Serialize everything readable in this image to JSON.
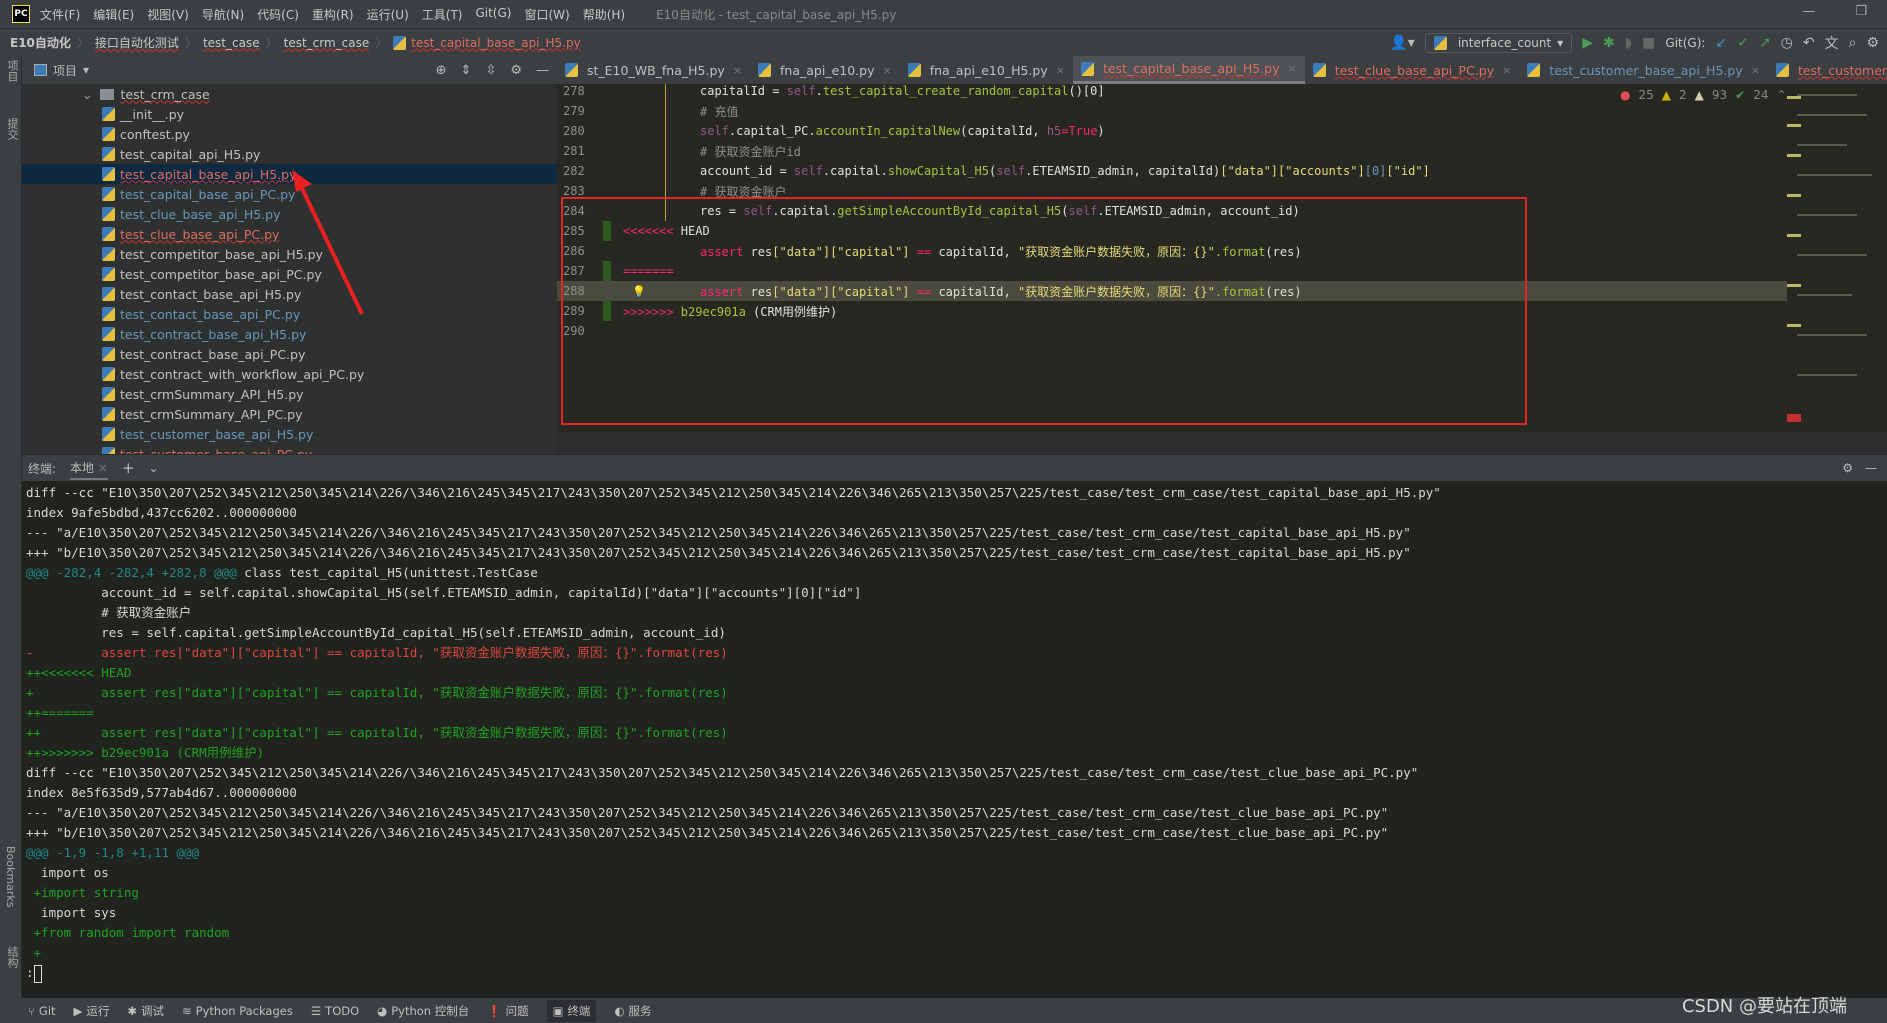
{
  "title_bar": {
    "logo": "PC",
    "menus": [
      "文件(F)",
      "编辑(E)",
      "视图(V)",
      "导航(N)",
      "代码(C)",
      "重构(R)",
      "运行(U)",
      "工具(T)",
      "Git(G)",
      "窗口(W)",
      "帮助(H)"
    ],
    "window_title": "E10自动化 - test_capital_base_api_H5.py"
  },
  "breadcrumb": [
    "E10自动化",
    "接口自动化测试",
    "test_case",
    "test_crm_case",
    "test_capital_base_api_H5.py"
  ],
  "toolbar": {
    "run_config": "interface_count",
    "git_label": "Git(G):"
  },
  "left_strip": {
    "project": "项目",
    "commit": "提交",
    "bookmarks": "Bookmarks",
    "structure": "结构"
  },
  "project_panel": {
    "title": "项目",
    "folder": "test_crm_case",
    "files": [
      {
        "name": "__init__.py",
        "status": "norm"
      },
      {
        "name": "conftest.py",
        "status": "norm"
      },
      {
        "name": "test_capital_api_H5.py",
        "status": "norm"
      },
      {
        "name": "test_capital_base_api_H5.py",
        "status": "conf",
        "selected": true
      },
      {
        "name": "test_capital_base_api_PC.py",
        "status": "mod"
      },
      {
        "name": "test_clue_base_api_H5.py",
        "status": "mod"
      },
      {
        "name": "test_clue_base_api_PC.py",
        "status": "conf"
      },
      {
        "name": "test_competitor_base_api_H5.py",
        "status": "norm"
      },
      {
        "name": "test_competitor_base_api_PC.py",
        "status": "norm"
      },
      {
        "name": "test_contact_base_api_H5.py",
        "status": "norm"
      },
      {
        "name": "test_contact_base_api_PC.py",
        "status": "mod"
      },
      {
        "name": "test_contract_base_api_H5.py",
        "status": "mod"
      },
      {
        "name": "test_contract_base_api_PC.py",
        "status": "norm"
      },
      {
        "name": "test_contract_with_workflow_api_PC.py",
        "status": "norm"
      },
      {
        "name": "test_crmSummary_API_H5.py",
        "status": "norm"
      },
      {
        "name": "test_crmSummary_API_PC.py",
        "status": "norm"
      },
      {
        "name": "test_customer_base_api_H5.py",
        "status": "mod"
      },
      {
        "name": "test_customer_base_api_PC.py",
        "status": "conf"
      }
    ]
  },
  "tabs": [
    {
      "label": "st_E10_WB_fna_H5.py",
      "status": "norm"
    },
    {
      "label": "fna_api_e10.py",
      "status": "norm"
    },
    {
      "label": "fna_api_e10_H5.py",
      "status": "norm"
    },
    {
      "label": "test_capital_base_api_H5.py",
      "status": "conf",
      "active": true
    },
    {
      "label": "test_clue_base_api_PC.py",
      "status": "conf"
    },
    {
      "label": "test_customer_base_api_H5.py",
      "status": "mod"
    },
    {
      "label": "test_customer_base_api_PC.py",
      "status": "conf"
    }
  ],
  "inspections": {
    "errors": "25",
    "warnings": "2",
    "weak_warnings": "93",
    "ok": "24"
  },
  "editor": {
    "lines": [
      {
        "num": "278",
        "segs": [
          [
            "pl",
            "capitalId = "
          ],
          [
            "self",
            "self"
          ],
          [
            "pl",
            "."
          ],
          [
            "fn",
            "test_capital_create_random_capital"
          ],
          [
            "pl",
            "()[0]"
          ]
        ]
      },
      {
        "num": "279",
        "segs": [
          [
            "cm",
            "# 充值"
          ]
        ]
      },
      {
        "num": "280",
        "segs": [
          [
            "self",
            "self"
          ],
          [
            "pl",
            "."
          ],
          [
            "pl",
            "capital_PC"
          ],
          [
            "pl",
            "."
          ],
          [
            "fn",
            "accountIn_capitalNew"
          ],
          [
            "pl",
            "(capitalId, "
          ],
          [
            "self",
            "h5"
          ],
          [
            "kw",
            "="
          ],
          [
            "kw",
            "True"
          ],
          [
            "pl",
            ")"
          ]
        ]
      },
      {
        "num": "281",
        "segs": [
          [
            "cm",
            "# 获取资金账户id"
          ]
        ]
      },
      {
        "num": "282",
        "segs": [
          [
            "pl",
            "account_id = "
          ],
          [
            "self",
            "self"
          ],
          [
            "pl",
            ".capital."
          ],
          [
            "fn",
            "showCapital_H5"
          ],
          [
            "pl",
            "("
          ],
          [
            "self",
            "self"
          ],
          [
            "pl",
            ".ETEAMSID_admin, capitalId)"
          ],
          [
            "str",
            "[\"data\"]"
          ],
          [
            "str",
            "[\"accounts\"]"
          ],
          [
            "num",
            "[0]"
          ],
          [
            "str",
            "[\"id\"]"
          ]
        ]
      },
      {
        "num": "283",
        "segs": [
          [
            "cm",
            "# 获取资金账户"
          ]
        ]
      },
      {
        "num": "284",
        "segs": [
          [
            "pl",
            "res = "
          ],
          [
            "self",
            "self"
          ],
          [
            "pl",
            ".capital."
          ],
          [
            "fn",
            "getSimpleAccountById_capital_H5"
          ],
          [
            "pl",
            "("
          ],
          [
            "self",
            "self"
          ],
          [
            "pl",
            ".ETEAMSID_admin, account_id)"
          ]
        ]
      },
      {
        "num": "285",
        "marker": true,
        "segs": [
          [
            "mk",
            "<<<<<<< "
          ],
          [
            "pl",
            "HEAD"
          ]
        ]
      },
      {
        "num": "286",
        "segs": [
          [
            "kw",
            "assert"
          ],
          [
            "pl",
            " res"
          ],
          [
            "str",
            "[\"data\"][\"capital\"]"
          ],
          [
            "kw",
            " == "
          ],
          [
            "pl",
            "capitalId, "
          ],
          [
            "str",
            "\"获取资金账户数据失败，原因：{}\""
          ],
          [
            "fn",
            ".format"
          ],
          [
            "pl",
            "(res)"
          ]
        ]
      },
      {
        "num": "287",
        "marker": true,
        "segs": [
          [
            "mk",
            "======="
          ]
        ]
      },
      {
        "num": "288",
        "highlight": true,
        "segs": [
          [
            "kw",
            "assert"
          ],
          [
            "pl",
            " res"
          ],
          [
            "str",
            "[\"data\"][\"capital\"]"
          ],
          [
            "kw",
            " == "
          ],
          [
            "pl",
            "capitalId, "
          ],
          [
            "str",
            "\"获取资金账户数据失败，原因：{}\""
          ],
          [
            "fn",
            ".format"
          ],
          [
            "pl",
            "(res)"
          ]
        ]
      },
      {
        "num": "289",
        "marker": true,
        "segs": [
          [
            "mk",
            ">>>>>>> "
          ],
          [
            "fn",
            "b29ec901a "
          ],
          [
            "pl",
            "(CRM用例维护)"
          ]
        ]
      },
      {
        "num": "290",
        "segs": []
      }
    ]
  },
  "terminal": {
    "tab_label": "终端:",
    "session": "本地",
    "lines": [
      {
        "c": "w",
        "t": "diff --cc \"E10\\350\\207\\252\\345\\212\\250\\345\\214\\226/\\346\\216\\245\\345\\217\\243\\350\\207\\252\\345\\212\\250\\345\\214\\226\\346\\265\\213\\350\\257\\225/test_case/test_crm_case/test_capital_base_api_H5.py\""
      },
      {
        "c": "w",
        "t": "index 9afe5bdbd,437cc6202..000000000"
      },
      {
        "c": "w",
        "t": "--- \"a/E10\\350\\207\\252\\345\\212\\250\\345\\214\\226/\\346\\216\\245\\345\\217\\243\\350\\207\\252\\345\\212\\250\\345\\214\\226\\346\\265\\213\\350\\257\\225/test_case/test_crm_case/test_capital_base_api_H5.py\""
      },
      {
        "c": "w",
        "t": "+++ \"b/E10\\350\\207\\252\\345\\212\\250\\345\\214\\226/\\346\\216\\245\\345\\217\\243\\350\\207\\252\\345\\212\\250\\345\\214\\226\\346\\265\\213\\350\\257\\225/test_case/test_crm_case/test_capital_base_api_H5.py\""
      },
      {
        "c": "c",
        "t": "@@@ -282,4 -282,4 +282,8 @@@",
        "rest": " class test_capital_H5(unittest.TestCase"
      },
      {
        "c": "w",
        "t": "          account_id = self.capital.showCapital_H5(self.ETEAMSID_admin, capitalId)[\"data\"][\"accounts\"][0][\"id\"]"
      },
      {
        "c": "w",
        "t": "          # 获取资金账户"
      },
      {
        "c": "w",
        "t": "          res = self.capital.getSimpleAccountById_capital_H5(self.ETEAMSID_admin, account_id)"
      },
      {
        "c": "r",
        "t": "-         assert res[\"data\"][\"capital\"] == capitalId, \"获取资金账户数据失败，原因：{}\".format(res)"
      },
      {
        "c": "g",
        "t": "++<<<<<<< HEAD"
      },
      {
        "c": "g",
        "t": "+         assert res[\"data\"][\"capital\"] == capitalId, \"获取资金账户数据失败，原因：{}\".format(res)"
      },
      {
        "c": "g",
        "t": "++======="
      },
      {
        "c": "g",
        "t": "++        assert res[\"data\"][\"capital\"] == capitalId, \"获取资金账户数据失败，原因：{}\".format(res)"
      },
      {
        "c": "g",
        "t": "++>>>>>>> b29ec901a (CRM用例维护)"
      },
      {
        "c": "w",
        "t": "diff --cc \"E10\\350\\207\\252\\345\\212\\250\\345\\214\\226/\\346\\216\\245\\345\\217\\243\\350\\207\\252\\345\\212\\250\\345\\214\\226\\346\\265\\213\\350\\257\\225/test_case/test_crm_case/test_clue_base_api_PC.py\""
      },
      {
        "c": "w",
        "t": "index 8e5f635d9,577ab4d67..000000000"
      },
      {
        "c": "w",
        "t": "--- \"a/E10\\350\\207\\252\\345\\212\\250\\345\\214\\226/\\346\\216\\245\\345\\217\\243\\350\\207\\252\\345\\212\\250\\345\\214\\226\\346\\265\\213\\350\\257\\225/test_case/test_crm_case/test_clue_base_api_PC.py\""
      },
      {
        "c": "w",
        "t": "+++ \"b/E10\\350\\207\\252\\345\\212\\250\\345\\214\\226/\\346\\216\\245\\345\\217\\243\\350\\207\\252\\345\\212\\250\\345\\214\\226\\346\\265\\213\\350\\257\\225/test_case/test_crm_case/test_clue_base_api_PC.py\""
      },
      {
        "c": "c",
        "t": "@@@ -1,9 -1,8 +1,11 @@@"
      },
      {
        "c": "w",
        "t": "  import os"
      },
      {
        "c": "g",
        "t": " +import string"
      },
      {
        "c": "w",
        "t": "  import sys"
      },
      {
        "c": "g",
        "t": " +from random import random"
      },
      {
        "c": "g",
        "t": " +"
      },
      {
        "c": "w",
        "t": ":"
      }
    ]
  },
  "status_bar": [
    "Git",
    "运行",
    "调试",
    "Python Packages",
    "TODO",
    "Python 控制台",
    "问题",
    "终端",
    "服务"
  ],
  "status_active": "终端",
  "watermark": "CSDN @要站在顶端"
}
